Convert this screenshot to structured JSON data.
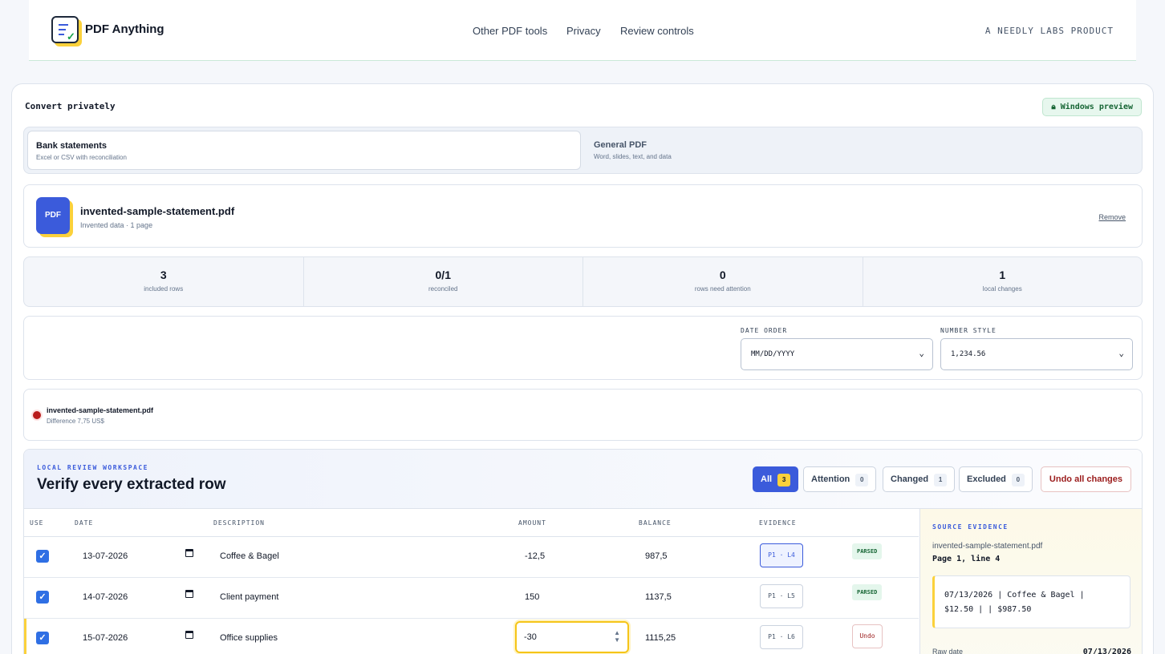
{
  "header": {
    "brand": "PDF Anything",
    "nav": [
      "Other PDF tools",
      "Privacy",
      "Review controls"
    ],
    "tagline": "A NEEDLY LABS PRODUCT"
  },
  "converter": {
    "title": "Convert privately",
    "badge": "Windows preview",
    "modes": [
      {
        "title": "Bank statements",
        "subtitle": "Excel or CSV with reconciliation",
        "active": true
      },
      {
        "title": "General PDF",
        "subtitle": "Word, slides, text, and data",
        "active": false
      }
    ]
  },
  "file": {
    "icon_label": "PDF",
    "name": "invented-sample-statement.pdf",
    "meta": "Invented data · 1 page",
    "remove_label": "Remove"
  },
  "stats": [
    {
      "value": "3",
      "label": "included rows"
    },
    {
      "value": "0/1",
      "label": "reconciled"
    },
    {
      "value": "0",
      "label": "rows need attention"
    },
    {
      "value": "1",
      "label": "local changes"
    }
  ],
  "options": {
    "date_order_label": "DATE ORDER",
    "date_order_value": "MM/DD/YYYY",
    "number_style_label": "NUMBER STYLE",
    "number_style_value": "1,234.56"
  },
  "reconciliation": {
    "file": "invented-sample-statement.pdf",
    "difference": "Difference 7,75 US$",
    "status_color": "#b91c1c"
  },
  "workspace": {
    "kicker": "LOCAL REVIEW WORKSPACE",
    "title": "Verify every extracted row",
    "filters": [
      {
        "label": "All",
        "count": "3",
        "active": true
      },
      {
        "label": "Attention",
        "count": "0",
        "active": false
      },
      {
        "label": "Changed",
        "count": "1",
        "active": false
      },
      {
        "label": "Excluded",
        "count": "0",
        "active": false
      }
    ],
    "undo_all_label": "Undo all changes",
    "columns": [
      "USE",
      "DATE",
      "DESCRIPTION",
      "AMOUNT",
      "BALANCE",
      "EVIDENCE"
    ],
    "rows": [
      {
        "use": true,
        "date": "13-07-2026",
        "description": "Coffee & Bagel",
        "amount": "-12,5",
        "balance": "987,5",
        "evidence": "P1 · L4",
        "status": "PARSED"
      },
      {
        "use": true,
        "date": "14-07-2026",
        "description": "Client payment",
        "amount": "150",
        "balance": "1137,5",
        "evidence": "P1 · L5",
        "status": "PARSED"
      },
      {
        "use": true,
        "date": "15-07-2026",
        "description": "Office supplies",
        "amount": "-30",
        "balance": "1115,25",
        "evidence": "P1 · L6",
        "status": "Undo"
      }
    ]
  },
  "source_evidence": {
    "kicker": "SOURCE EVIDENCE",
    "file": "invented-sample-statement.pdf",
    "location": "Page 1, line 4",
    "snippet_line1": "07/13/2026 | Coffee & Bagel |",
    "snippet_line2": "$12.50 | | $987.50",
    "raw_date_label": "Raw date",
    "raw_date_value": "07/13/2026"
  },
  "colors": {
    "accent": "#3b5bdb",
    "highlight": "#fbd13b",
    "danger": "#9b1c1c",
    "success": "#166534"
  }
}
